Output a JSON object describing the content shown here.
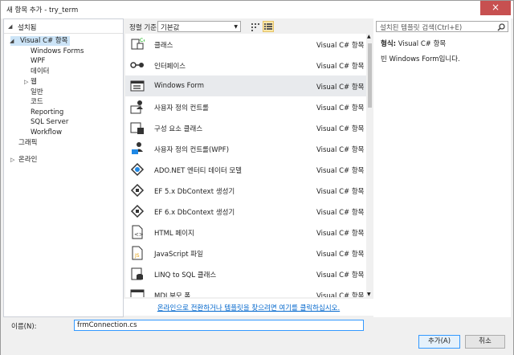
{
  "window": {
    "title": "새 항목 추가 - try_term",
    "close": "×"
  },
  "left": {
    "header": "설치됨",
    "tree": [
      {
        "label": "Visual C# 항목",
        "level": 0,
        "expanded": true,
        "selected": true,
        "name": "tree-item-visual-csharp"
      },
      {
        "label": "Windows Forms",
        "level": 1,
        "name": "tree-item-windows-forms"
      },
      {
        "label": "WPF",
        "level": 1,
        "name": "tree-item-wpf"
      },
      {
        "label": "데이터",
        "level": 1,
        "name": "tree-item-data"
      },
      {
        "label": "웹",
        "level": 1,
        "collapsed": true,
        "name": "tree-item-web"
      },
      {
        "label": "일반",
        "level": 1,
        "name": "tree-item-general"
      },
      {
        "label": "코드",
        "level": 1,
        "name": "tree-item-code"
      },
      {
        "label": "Reporting",
        "level": 1,
        "name": "tree-item-reporting"
      },
      {
        "label": "SQL Server",
        "level": 1,
        "name": "tree-item-sql-server"
      },
      {
        "label": "Workflow",
        "level": 1,
        "name": "tree-item-workflow"
      },
      {
        "label": "그래픽",
        "level": 0,
        "name": "tree-item-graphics"
      }
    ],
    "online": "온라인"
  },
  "toolbar": {
    "sort_label": "정렬 기준:",
    "sort_value": "기본값"
  },
  "templates": [
    {
      "name": "클래스",
      "type": "Visual C# 항목",
      "icon": "class-icon"
    },
    {
      "name": "인터페이스",
      "type": "Visual C# 항목",
      "icon": "interface-icon"
    },
    {
      "name": "Windows Form",
      "type": "Visual C# 항목",
      "icon": "windows-form-icon",
      "selected": true
    },
    {
      "name": "사용자 정의 컨트롤",
      "type": "Visual C# 항목",
      "icon": "user-control-icon"
    },
    {
      "name": "구성 요소 클래스",
      "type": "Visual C# 항목",
      "icon": "component-class-icon"
    },
    {
      "name": "사용자 정의 컨트롤(WPF)",
      "type": "Visual C# 항목",
      "icon": "wpf-user-control-icon"
    },
    {
      "name": "ADO.NET 엔터티 데이터 모델",
      "type": "Visual C# 항목",
      "icon": "ado-net-entity-icon"
    },
    {
      "name": "EF 5.x DbContext 생성기",
      "type": "Visual C# 항목",
      "icon": "ef5-generator-icon"
    },
    {
      "name": "EF 6.x DbContext 생성기",
      "type": "Visual C# 항목",
      "icon": "ef6-generator-icon"
    },
    {
      "name": "HTML 페이지",
      "type": "Visual C# 항목",
      "icon": "html-page-icon"
    },
    {
      "name": "JavaScript 파일",
      "type": "Visual C# 항목",
      "icon": "javascript-file-icon"
    },
    {
      "name": "LINQ to SQL 클래스",
      "type": "Visual C# 항목",
      "icon": "linq-to-sql-icon"
    },
    {
      "name": "MDI 부모 폼",
      "type": "Visual C# 항목",
      "icon": "mdi-parent-form-icon"
    }
  ],
  "online_link": "온라인으로 전환하거나 템플릿을 찾으려면 여기를 클릭하십시오.",
  "search": {
    "placeholder": "설치된 템플릿 검색(Ctrl+E)"
  },
  "details": {
    "type_label": "형식:",
    "type_value": "Visual C# 항목",
    "description": "빈 Windows Form입니다."
  },
  "bottom": {
    "name_label": "이름(N):",
    "name_value": "frmConnection.cs",
    "add": "추가(A)",
    "cancel": "취소"
  }
}
